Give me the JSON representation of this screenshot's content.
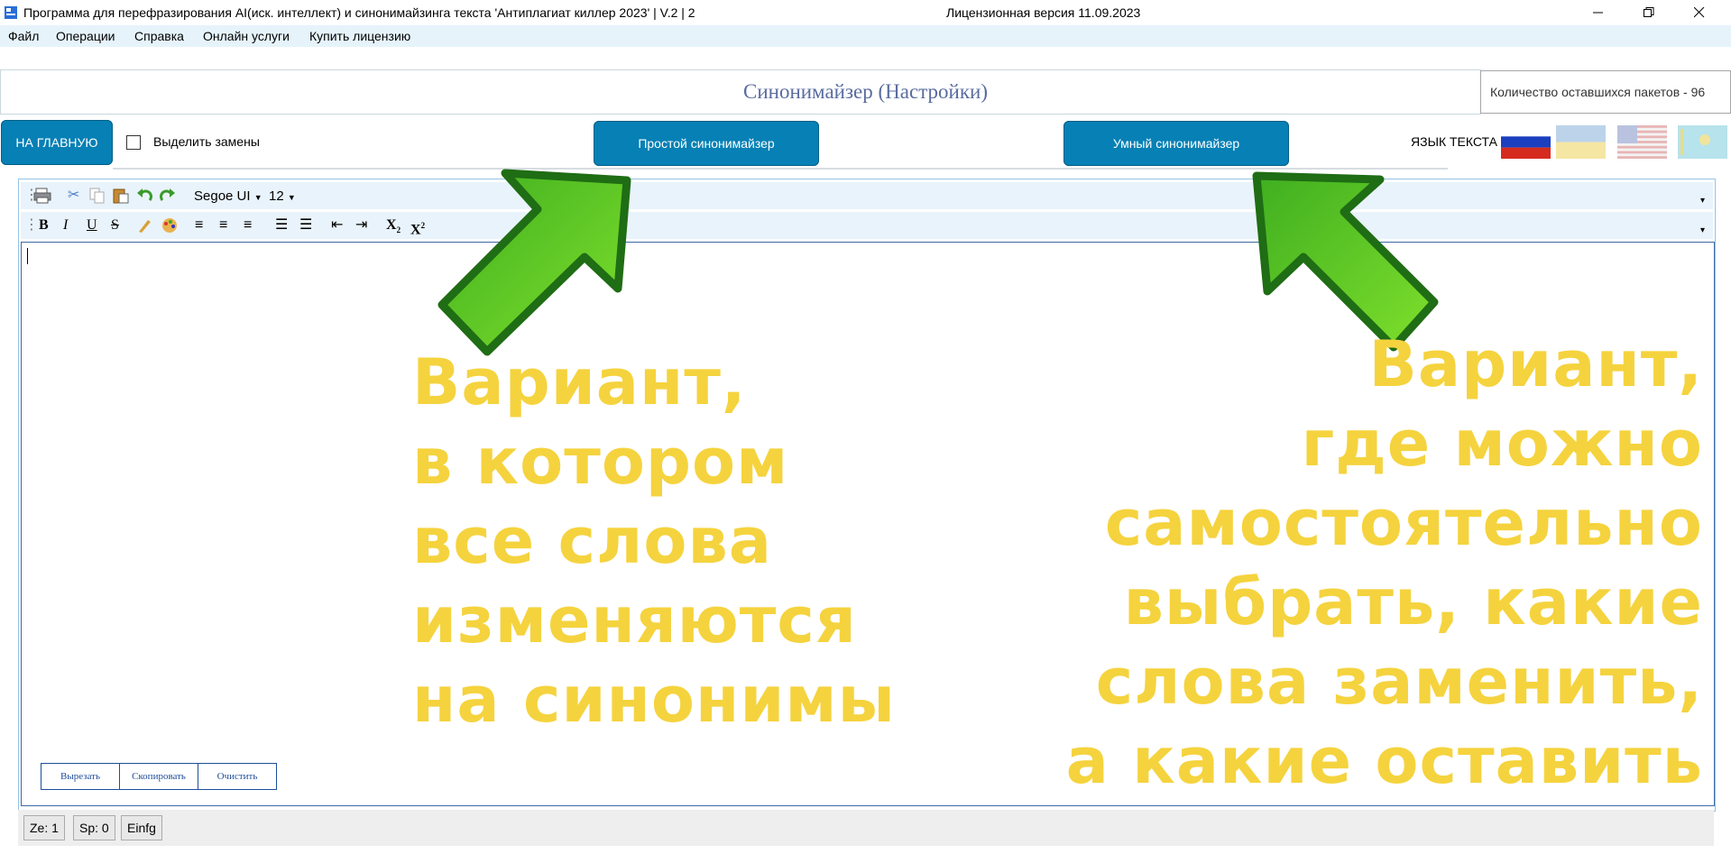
{
  "window": {
    "title": "Программа для перефразирования AI(иск. интеллект) и синонимайзинга текста 'Антиплагиат киллер 2023' | V.2 | 2",
    "license": "Лицензионная версия 11.09.2023"
  },
  "menu": [
    "Файл",
    "Операции",
    "Справка",
    "Онлайн услуги",
    "Купить лицензию"
  ],
  "header": {
    "title": "Синонимайзер (Настройки)",
    "packets": "Количество оставшихся пакетов - 96"
  },
  "toolbar": {
    "home_button": "НА ГЛАВНУЮ",
    "highlight_label": "Выделить замены",
    "highlight_checked": false,
    "simple_button": "Простой синонимайзер",
    "smart_button": "Умный синонимайзер",
    "lang_label": "ЯЗЫК ТЕКСТА"
  },
  "editor_toolbar": {
    "font": "Segoe UI",
    "size": "12"
  },
  "editor_buttons": [
    "Вырезать",
    "Скопировать",
    "Очистить"
  ],
  "status": [
    "Ze: 1",
    "Sp: 0",
    "Einfg"
  ],
  "annotations": {
    "left": [
      "Вариант,",
      "в котором",
      "все слова",
      "изменяются",
      "на синонимы"
    ],
    "right": [
      "Вариант,",
      "где можно",
      "самостоятельно",
      "выбрать, какие",
      "слова заменить,",
      "а какие оставить"
    ]
  },
  "colors": {
    "button_blue": "#0680b5",
    "annotation_yellow": "#f5d33e",
    "arrow_green": "#5cc22a"
  }
}
